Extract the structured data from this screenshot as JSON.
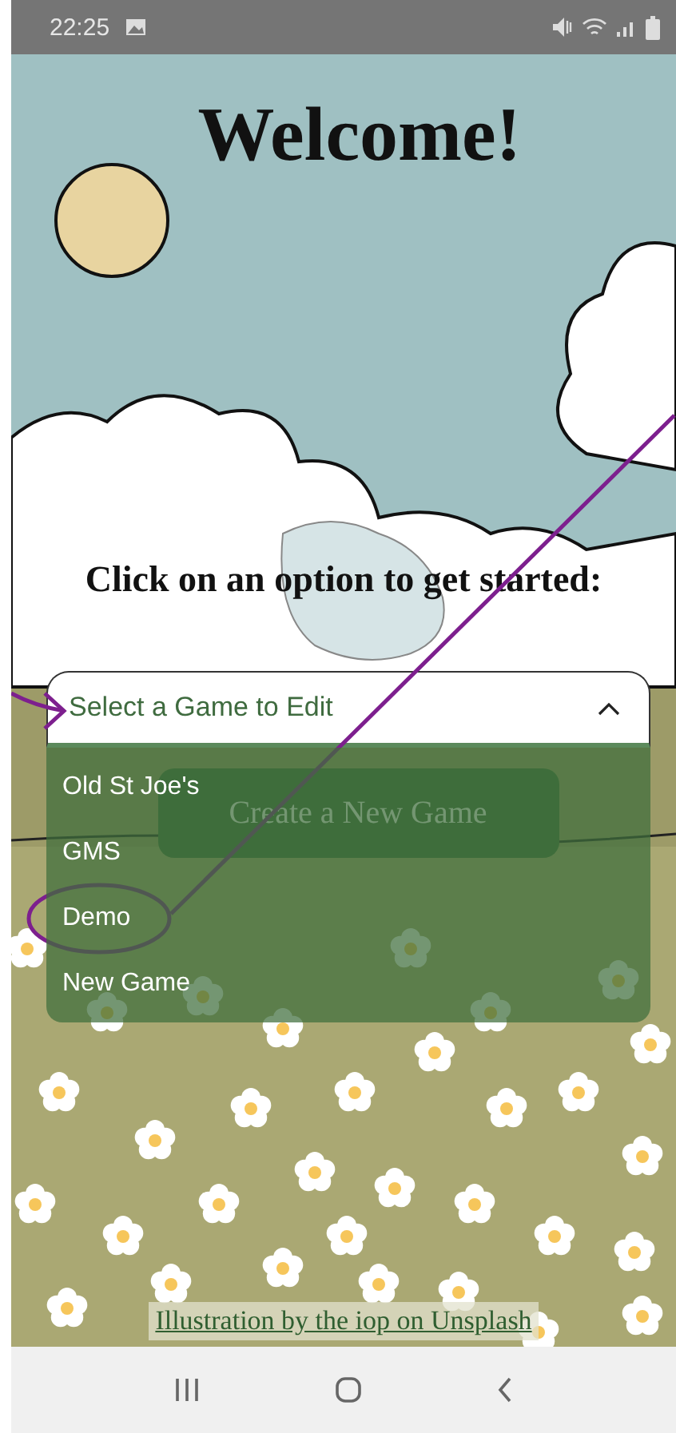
{
  "status_bar": {
    "time": "22:25"
  },
  "title": "Welcome!",
  "prompt": "Click on an option to get started:",
  "game_select": {
    "placeholder": "Select a Game to Edit",
    "expanded": true,
    "options": [
      {
        "label": "Old St Joe's",
        "selected": false
      },
      {
        "label": "GMS",
        "selected": false
      },
      {
        "label": "Demo",
        "selected": false
      },
      {
        "label": "New Game",
        "selected": false
      }
    ]
  },
  "create_button": {
    "label": "Create a New Game"
  },
  "credit_link": "Illustration by the iop on Unsplash"
}
